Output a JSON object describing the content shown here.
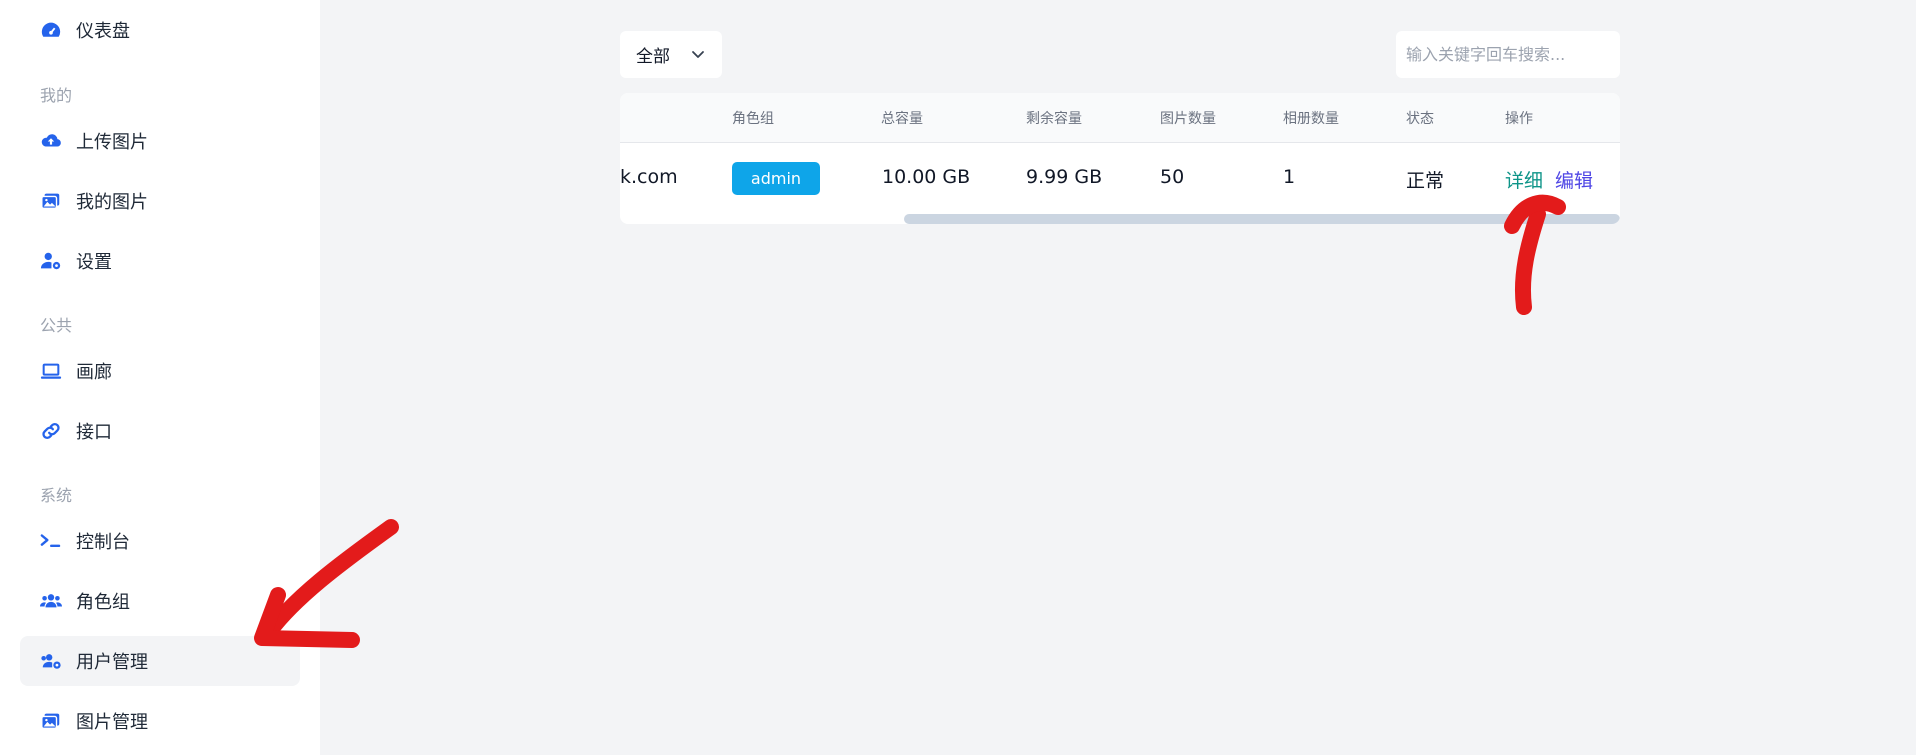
{
  "sidebar": {
    "dashboard": "仪表盘",
    "section_mine": "我的",
    "upload": "上传图片",
    "my_images": "我的图片",
    "settings": "设置",
    "section_public": "公共",
    "gallery": "画廊",
    "api": "接口",
    "section_system": "系统",
    "console": "控制台",
    "role_groups": "角色组",
    "user_management": "用户管理",
    "image_management": "图片管理",
    "active_item": "用户管理"
  },
  "toolbar": {
    "filter_value": "全部",
    "search_placeholder": "输入关键字回车搜索..."
  },
  "table": {
    "headers": [
      "角色组",
      "总容量",
      "剩余容量",
      "图片数量",
      "相册数量",
      "状态",
      "操作"
    ],
    "rows": [
      {
        "email_partial": "k.com",
        "role": "admin",
        "total_capacity": "10.00 GB",
        "remaining_capacity": "9.99 GB",
        "image_count": "50",
        "album_count": "1",
        "status": "正常",
        "action_detail": "详细",
        "action_edit": "编辑"
      }
    ]
  },
  "colors": {
    "accent_blue": "#2563eb",
    "role_badge": "#0ea5e9",
    "detail_link": "#0d9488",
    "edit_link": "#4f46e5",
    "annotation_red": "#e31b1b"
  },
  "icons": {
    "dashboard": "gauge-icon",
    "upload": "cloud-upload-icon",
    "my_images": "images-icon",
    "settings": "user-gear-icon",
    "gallery": "laptop-icon",
    "api": "link-icon",
    "console": "terminal-icon",
    "role_groups": "users-icon",
    "user_management": "users-gear-icon",
    "image_management": "images-icon",
    "filter_chevron": "chevron-down-icon"
  }
}
